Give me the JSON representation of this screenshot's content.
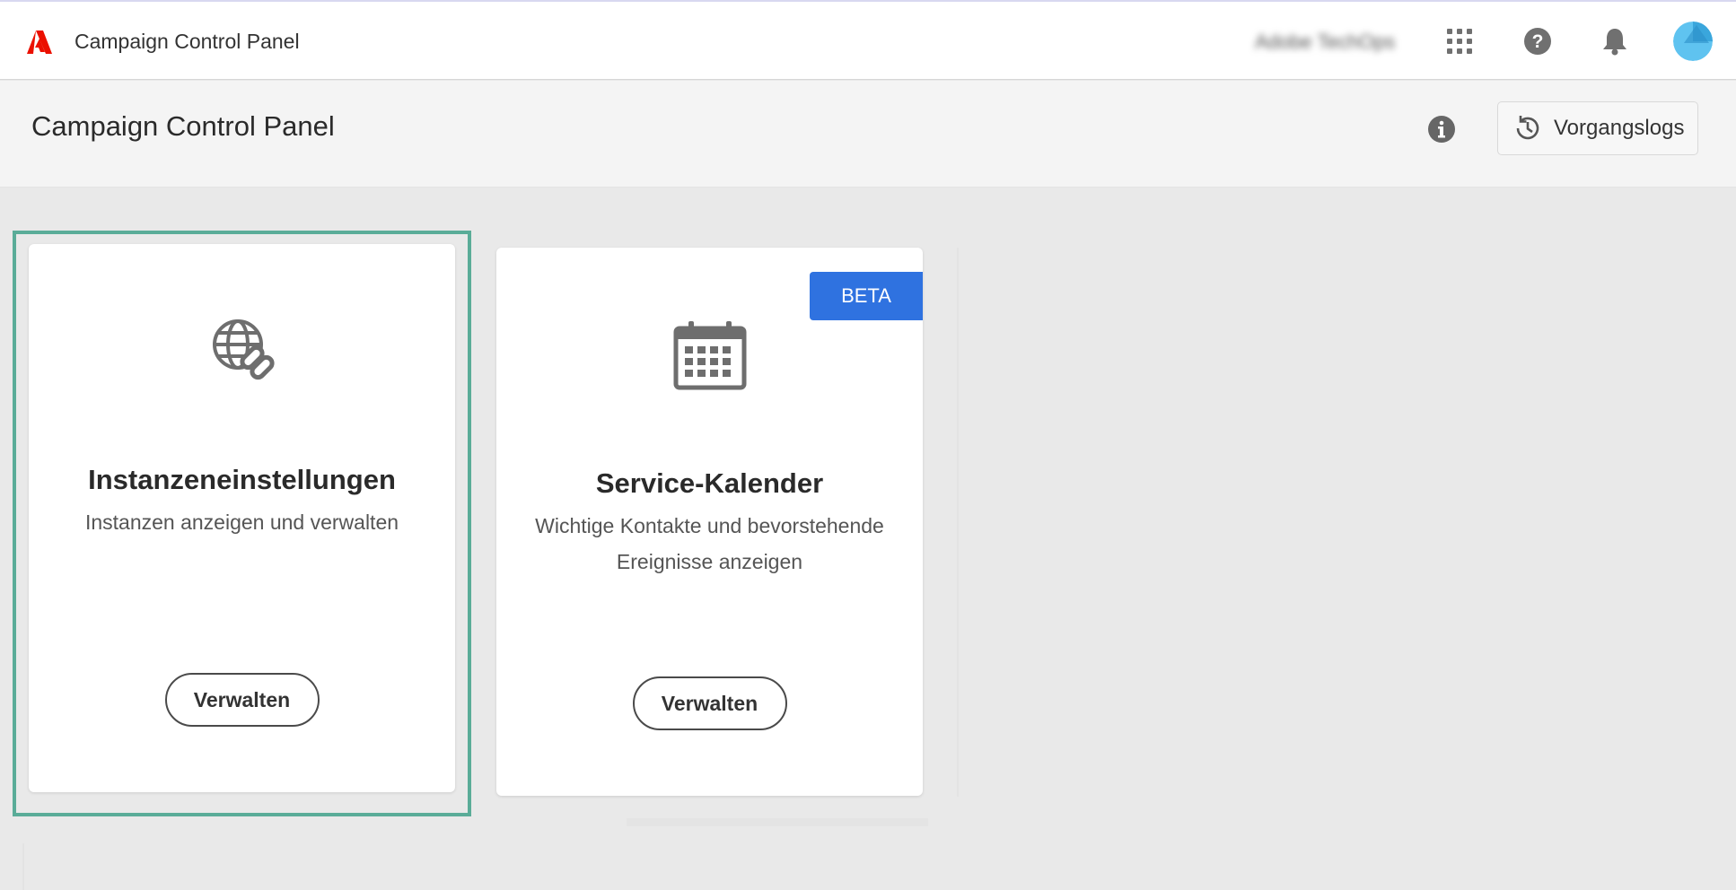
{
  "topbar": {
    "app_title": "Campaign Control Panel",
    "org_name": "Adobe TechOps",
    "icons": [
      "app-grid-icon",
      "help-icon",
      "bell-icon"
    ]
  },
  "header": {
    "title": "Campaign Control Panel",
    "logs_button_label": "Vorgangslogs"
  },
  "cards": [
    {
      "icon": "globe-link-icon",
      "title": "Instanzeneinstellungen",
      "description": "Instanzen anzeigen und verwalten",
      "button_label": "Verwalten",
      "highlighted": true
    },
    {
      "icon": "calendar-icon",
      "title": "Service-Kalender",
      "description": "Wichtige Kontakte und bevorstehende Ereignisse anzeigen",
      "button_label": "Verwalten",
      "badge": "BETA"
    }
  ],
  "colors": {
    "brand_red": "#eb1000",
    "badge_blue": "#2f72e0",
    "highlight_green": "#5aac98"
  }
}
